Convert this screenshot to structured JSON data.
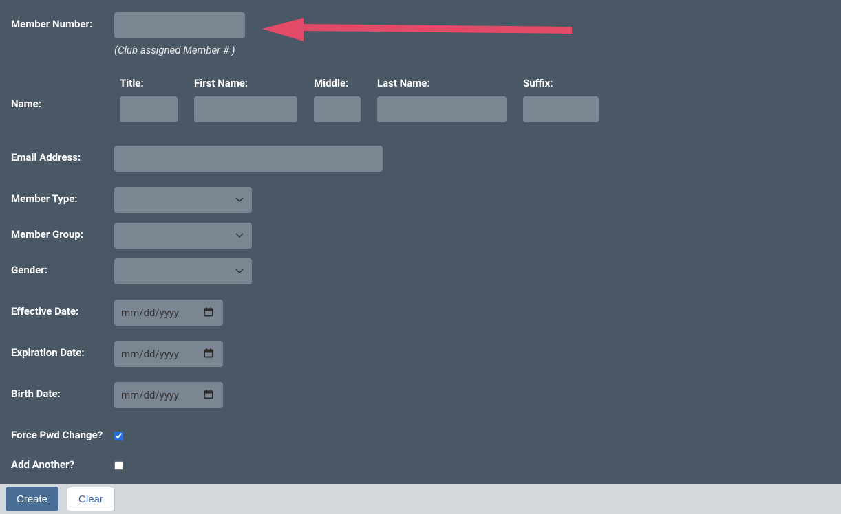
{
  "labels": {
    "memberNumber": "Member Number:",
    "memberNumberHint": "(Club assigned Member # )",
    "name": "Name:",
    "title": "Title:",
    "firstName": "First Name:",
    "middle": "Middle:",
    "lastName": "Last Name:",
    "suffix": "Suffix:",
    "email": "Email Address:",
    "memberType": "Member Type:",
    "memberGroup": "Member Group:",
    "gender": "Gender:",
    "effectiveDate": "Effective Date:",
    "expirationDate": "Expiration Date:",
    "birthDate": "Birth Date:",
    "forcePwd": "Force Pwd Change?",
    "addAnother": "Add Another?"
  },
  "values": {
    "memberNumber": "",
    "title": "",
    "firstName": "",
    "middle": "",
    "lastName": "",
    "suffix": "",
    "email": "",
    "memberType": "",
    "memberGroup": "",
    "gender": "",
    "effectiveDate": "mm/dd/yyyy",
    "expirationDate": "mm/dd/yyyy",
    "birthDate": "mm/dd/yyyy",
    "forcePwd": true,
    "addAnother": false
  },
  "buttons": {
    "create": "Create",
    "clear": "Clear"
  },
  "colors": {
    "arrow": "#e24a68"
  }
}
